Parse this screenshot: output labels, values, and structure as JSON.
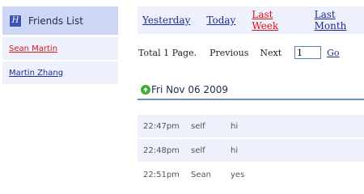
{
  "sidebar": {
    "title": "Friends List",
    "icon_letter": "H",
    "friends": [
      {
        "name": "Sean Martin",
        "active": true
      },
      {
        "name": "Martin Zhang",
        "active": false
      }
    ]
  },
  "period_nav": {
    "items": [
      {
        "label": "Yesterday",
        "active": false
      },
      {
        "label": "Today",
        "active": false
      },
      {
        "label": "Last Week",
        "active": true
      },
      {
        "label": "Last Month",
        "active": false
      }
    ]
  },
  "pager": {
    "total": "Total 1 Page.",
    "previous": "Previous",
    "next": "Next",
    "page_value": "1",
    "go": "Go"
  },
  "conversation": {
    "date": "Fri Nov 06 2009",
    "messages": [
      {
        "time": "22:47pm",
        "sender": "self",
        "text": "hi"
      },
      {
        "time": "22:48pm",
        "sender": "self",
        "text": "hi"
      },
      {
        "time": "22:51pm",
        "sender": "Sean",
        "text": "yes"
      }
    ]
  },
  "colors": {
    "header_bg": "#ccd6f5",
    "row_bg": "#eef1fb",
    "link": "#1c2c91",
    "active_link": "#e0141b",
    "divider": "#6f8fbf",
    "up_icon": "#3eae2d"
  }
}
